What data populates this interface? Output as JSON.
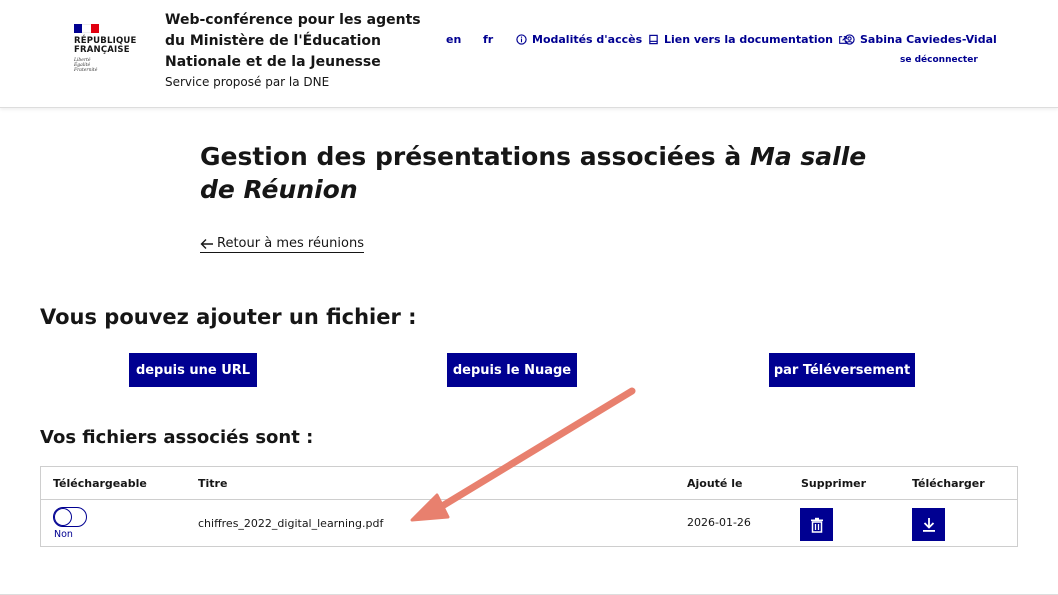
{
  "header": {
    "logo_text": [
      "RÉPUBLIQUE",
      "FRANÇAISE"
    ],
    "logo_motto": [
      "Liberté",
      "Égalité",
      "Fraternité"
    ],
    "service_title_lines": [
      "Web-conférence pour les agents",
      "du Ministère de l'Éducation",
      "Nationale et de la Jeunesse"
    ],
    "service_subtitle": "Service proposé par la DNE",
    "lang_en": "en",
    "lang_fr": "fr",
    "access_label": "Modalités d'accès",
    "doc_label": "Lien vers la documentation",
    "user_name": "Sabina Caviedes-Vidal",
    "logout_label": "se déconnecter"
  },
  "main": {
    "title_prefix": "Gestion des présentations associées à ",
    "room_name": "Ma salle de Réunion",
    "back_label": "Retour à mes réunions",
    "add_heading": "Vous pouvez ajouter un fichier :",
    "buttons": {
      "url": "depuis une URL",
      "cloud": "depuis le Nuage",
      "upload": "par Téléversement"
    },
    "files_heading": "Vos fichiers associés sont :"
  },
  "table": {
    "headers": {
      "downloadable": "Téléchargeable",
      "title": "Titre",
      "added": "Ajouté le",
      "delete": "Supprimer",
      "download": "Télécharger"
    },
    "rows": [
      {
        "downloadable_label": "Non",
        "downloadable": false,
        "title": "chiffres_2022_digital_learning.pdf",
        "added": "2026-01-26"
      }
    ]
  },
  "colors": {
    "primary": "#000091",
    "annotation_arrow": "#e8806e",
    "flag_blue": "#000091",
    "flag_red": "#e1000f"
  },
  "icons": {
    "access": "info-circle-icon",
    "doc": "book-icon",
    "external": "external-link-icon",
    "user": "user-circle-icon",
    "back": "arrow-left-icon",
    "delete": "trash-icon",
    "download": "download-icon"
  }
}
